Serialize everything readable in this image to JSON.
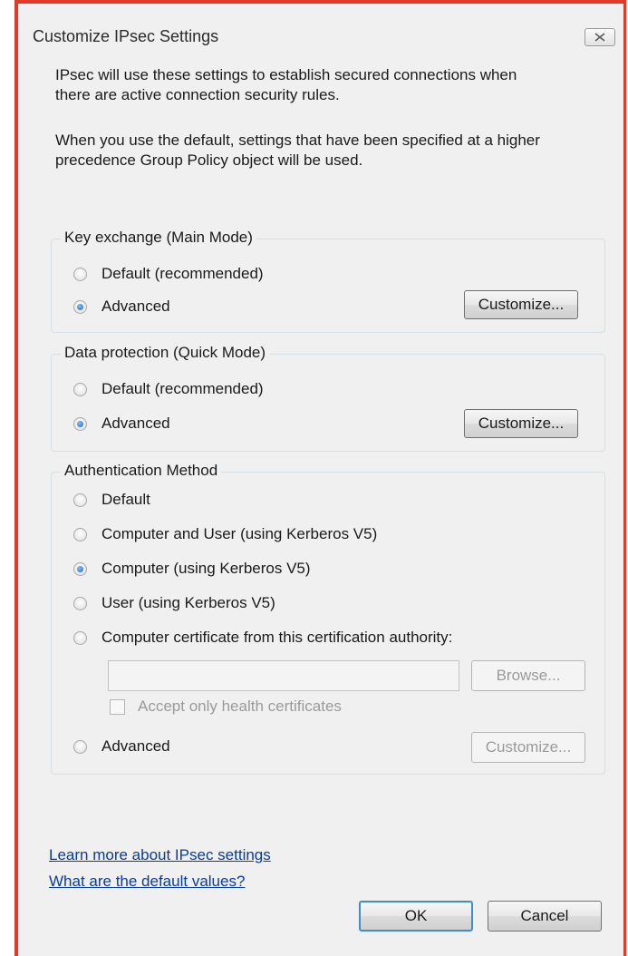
{
  "window": {
    "title": "Customize IPsec Settings"
  },
  "intro": {
    "paragraph1_line1": "IPsec will use these settings to establish secured connections when",
    "paragraph1_line2": "there are active connection security rules.",
    "paragraph2_line1": "When you use the default, settings that have been specified at a higher",
    "paragraph2_line2": "precedence Group Policy object will be used."
  },
  "key_exchange": {
    "legend": "Key exchange (Main Mode)",
    "options": [
      {
        "label": "Default (recommended)",
        "checked": false
      },
      {
        "label": "Advanced",
        "checked": true
      }
    ],
    "customize_label": "Customize..."
  },
  "data_protection": {
    "legend": "Data protection (Quick Mode)",
    "options": [
      {
        "label": "Default (recommended)",
        "checked": false
      },
      {
        "label": "Advanced",
        "checked": true
      }
    ],
    "customize_label": "Customize..."
  },
  "authentication": {
    "legend": "Authentication Method",
    "options": [
      {
        "label": "Default",
        "checked": false
      },
      {
        "label": "Computer and User (using Kerberos V5)",
        "checked": false
      },
      {
        "label": "Computer (using Kerberos V5)",
        "checked": true
      },
      {
        "label": "User (using Kerberos V5)",
        "checked": false
      },
      {
        "label": "Computer certificate from this certification authority:",
        "checked": false
      }
    ],
    "ca_value": "",
    "browse_label": "Browse...",
    "health_cert_label": "Accept only health certificates",
    "advanced_label": "Advanced",
    "advanced_checked": false,
    "customize_label": "Customize..."
  },
  "links": {
    "learn_more": "Learn more about IPsec settings",
    "defaults": "What are the default values?"
  },
  "footer": {
    "ok_label": "OK",
    "cancel_label": "Cancel"
  },
  "colors": {
    "accent_border": "#e23a2a",
    "link": "#0a3c9c",
    "group_border": "#d5dfe5"
  }
}
